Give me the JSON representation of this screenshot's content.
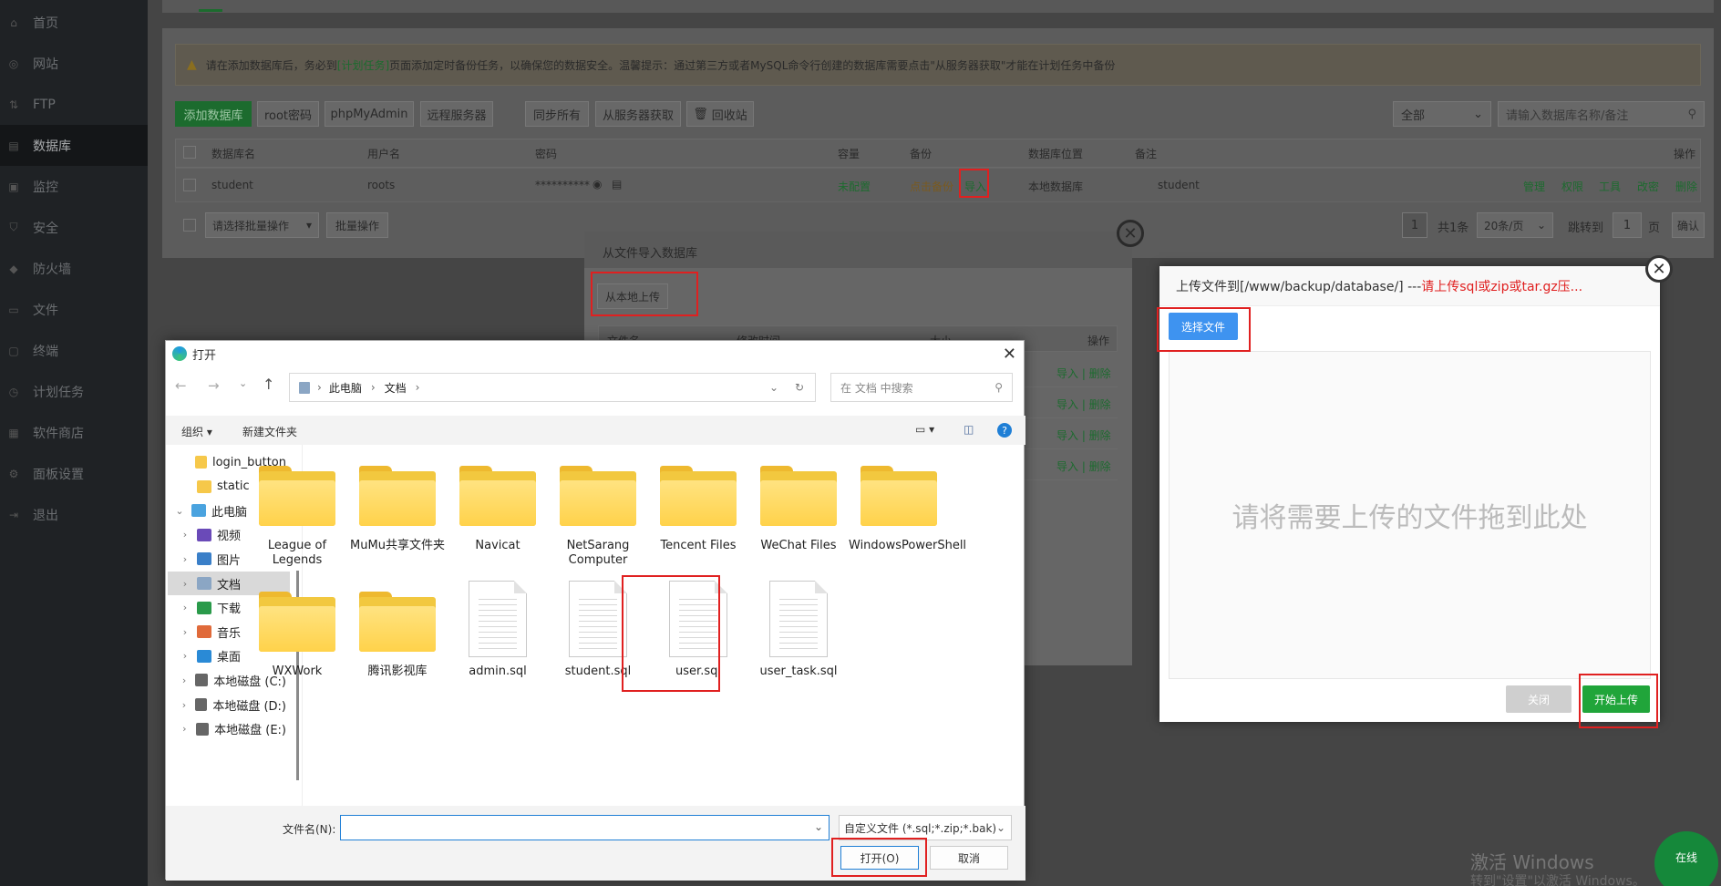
{
  "sidebar": {
    "items": [
      {
        "label": "首页",
        "icon": "home-icon"
      },
      {
        "label": "网站",
        "icon": "globe-icon"
      },
      {
        "label": "FTP",
        "icon": "ftp-icon"
      },
      {
        "label": "数据库",
        "icon": "database-icon",
        "active": true
      },
      {
        "label": "监控",
        "icon": "monitor-icon"
      },
      {
        "label": "安全",
        "icon": "shield-icon"
      },
      {
        "label": "防火墙",
        "icon": "firewall-icon"
      },
      {
        "label": "文件",
        "icon": "folder-icon"
      },
      {
        "label": "终端",
        "icon": "terminal-icon"
      },
      {
        "label": "计划任务",
        "icon": "clock-icon"
      },
      {
        "label": "软件商店",
        "icon": "store-icon"
      },
      {
        "label": "面板设置",
        "icon": "gear-icon"
      },
      {
        "label": "退出",
        "icon": "logout-icon"
      }
    ]
  },
  "warning": {
    "pre": "请在添加数据库后，务必到",
    "link": "[计划任务]",
    "post": "页面添加定时备份任务，以确保您的数据安全。温馨提示：通过第三方或者MySQL命令行创建的数据库需要点击\"从服务器获取\"才能在计划任务中备份"
  },
  "toolbar": {
    "add_db": "添加数据库",
    "root_pwd": "root密码",
    "phpmyadmin": "phpMyAdmin",
    "remote": "远程服务器",
    "sync_all": "同步所有",
    "fetch_server": "从服务器获取",
    "recycle": "回收站",
    "filter_value": "全部",
    "search_placeholder": "请输入数据库名称/备注"
  },
  "table": {
    "headers": [
      "数据库名",
      "用户名",
      "密码",
      "容量",
      "备份",
      "数据库位置",
      "备注",
      "操作"
    ],
    "row": {
      "name": "student",
      "user": "roots",
      "password": "**********",
      "capacity": "未配置",
      "backup": "点击备份",
      "import": "导入",
      "location": "本地数据库",
      "note": "student",
      "ops": [
        "管理",
        "权限",
        "工具",
        "改密",
        "删除"
      ]
    },
    "batch_placeholder": "请选择批量操作",
    "batch_btn": "批量操作",
    "pager": {
      "page": "1",
      "total": "共1条",
      "per_page": "20条/页",
      "jump": "跳转到",
      "jump_val": "1",
      "page_unit": "页",
      "confirm": "确认"
    }
  },
  "import_dialog": {
    "title": "从文件导入数据库",
    "local_upload": "从本地上传",
    "col_file": "文件名",
    "col_time": "修改时间",
    "col_size": "大小",
    "col_op": "操作",
    "row_op": "导入 | 删除"
  },
  "upload_dialog": {
    "title_prefix": "上传文件到[/www/backup/database/] --- ",
    "title_warn": "请上传sql或zip或tar.gz压...",
    "choose": "选择文件",
    "drop_hint": "请将需要上传的文件拖到此处",
    "close": "关闭",
    "start": "开始上传"
  },
  "file_dialog": {
    "title": "打开",
    "path": [
      "此电脑",
      "文档"
    ],
    "search_placeholder": "在 文档 中搜索",
    "organize": "组织 ▾",
    "new_folder": "新建文件夹",
    "tree": [
      {
        "label": "login_button",
        "type": "folder",
        "indent": 1
      },
      {
        "label": "static",
        "type": "folder",
        "indent": 1
      },
      {
        "label": "此电脑",
        "type": "pc",
        "indent": 0,
        "expanded": true
      },
      {
        "label": "视频",
        "type": "video",
        "indent": 1
      },
      {
        "label": "图片",
        "type": "picture",
        "indent": 1
      },
      {
        "label": "文档",
        "type": "doc",
        "indent": 1,
        "selected": true
      },
      {
        "label": "下载",
        "type": "download",
        "indent": 1
      },
      {
        "label": "音乐",
        "type": "music",
        "indent": 1
      },
      {
        "label": "桌面",
        "type": "desktop",
        "indent": 1
      },
      {
        "label": "本地磁盘 (C:)",
        "type": "disk",
        "indent": 1
      },
      {
        "label": "本地磁盘 (D:)",
        "type": "disk",
        "indent": 1
      },
      {
        "label": "本地磁盘 (E:)",
        "type": "disk",
        "indent": 1
      }
    ],
    "files": [
      {
        "label": "League of Legends",
        "type": "folder"
      },
      {
        "label": "MuMu共享文件夹",
        "type": "folder"
      },
      {
        "label": "Navicat",
        "type": "folder"
      },
      {
        "label": "NetSarang Computer",
        "type": "folder"
      },
      {
        "label": "Tencent Files",
        "type": "folder"
      },
      {
        "label": "WeChat Files",
        "type": "folder"
      },
      {
        "label": "WindowsPowerShell",
        "type": "folder"
      },
      {
        "label": "WXWork",
        "type": "folder"
      },
      {
        "label": "腾讯影视库",
        "type": "folder"
      },
      {
        "label": "admin.sql",
        "type": "file"
      },
      {
        "label": "student.sql",
        "type": "file"
      },
      {
        "label": "user.sql",
        "type": "file"
      },
      {
        "label": "user_task.sql",
        "type": "file"
      }
    ],
    "filename_label": "文件名(N):",
    "filename_value": "",
    "filetype": "自定义文件 (*.sql;*.zip;*.bak)",
    "open": "打开(O)",
    "cancel": "取消"
  },
  "watermark": {
    "line1": "激活 Windows",
    "line2": "转到\"设置\"以激活 Windows。"
  },
  "online_badge": "在线",
  "colors": {
    "accent_green": "#20a53a",
    "accent_blue": "#3e93f0",
    "highlight_red": "#e02020"
  }
}
